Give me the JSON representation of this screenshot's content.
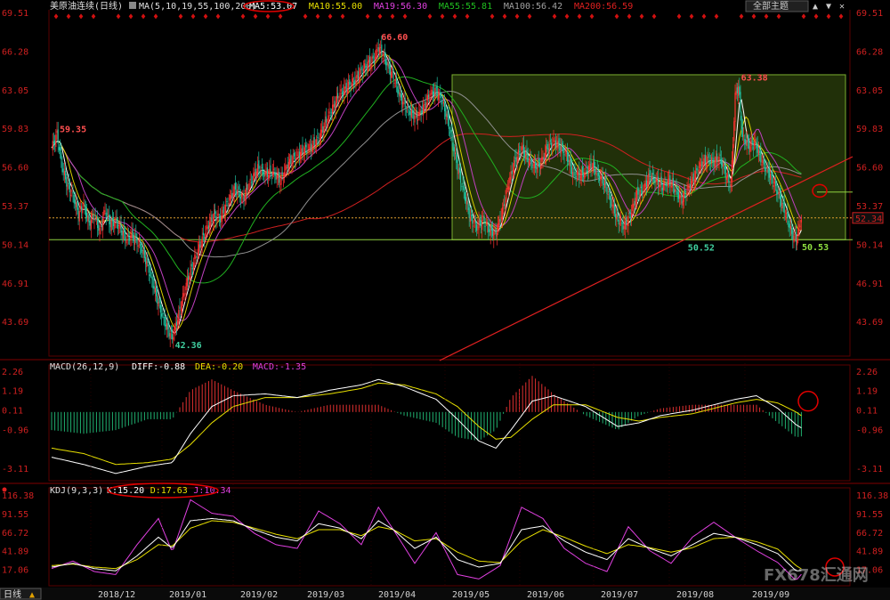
{
  "header": {
    "instrument": "美原油连续(日线)",
    "ma_params": "MA(5,10,19,55,100,200)",
    "ma_values": [
      {
        "label": "MA5:53.07",
        "color": "#ffffff"
      },
      {
        "label": "MA10:55.00",
        "color": "#e8e000"
      },
      {
        "label": "MA19:56.30",
        "color": "#e040e0"
      },
      {
        "label": "MA55:55.81",
        "color": "#20c020"
      },
      {
        "label": "MA100:56.42",
        "color": "#a0a0a0"
      },
      {
        "label": "MA200:56.59",
        "color": "#e02020"
      }
    ],
    "theme_button": "全部主题",
    "macd_header": "MACD(26,12,9)",
    "macd_values": [
      {
        "label": "DIFF:-0.88",
        "color": "#ffffff"
      },
      {
        "label": "DEA:-0.20",
        "color": "#e8e000"
      },
      {
        "label": "MACD:-1.35",
        "color": "#e040e0"
      }
    ],
    "kdj_header": "KDJ(9,3,3)",
    "kdj_values": [
      {
        "label": "K:15.20",
        "color": "#ffffff"
      },
      {
        "label": "D:17.63",
        "color": "#e8e000"
      },
      {
        "label": "J:10.34",
        "color": "#e040e0"
      }
    ],
    "period_tab": "日线",
    "watermark": "FX678汇通网"
  },
  "chart_data": [
    {
      "type": "candlestick",
      "yticks": [
        "69.51",
        "66.28",
        "63.05",
        "59.83",
        "56.60",
        "53.37",
        "50.14",
        "46.91",
        "43.69"
      ],
      "ylim": [
        40.8,
        69.8
      ],
      "xticks": [
        "2018/12",
        "2019/01",
        "2019/02",
        "2019/03",
        "2019/04",
        "2019/05",
        "2019/06",
        "2019/07",
        "2019/08",
        "2019/09"
      ],
      "current_price": "52.34",
      "annotations": [
        "59.35",
        "42.36",
        "66.60",
        "63.38",
        "50.52",
        "50.53"
      ],
      "price_path": [
        [
          0,
          58.2
        ],
        [
          5,
          59.35
        ],
        [
          10,
          56.5
        ],
        [
          15,
          55.0
        ],
        [
          20,
          54.2
        ],
        [
          25,
          52.7
        ],
        [
          30,
          53.4
        ],
        [
          35,
          51.9
        ],
        [
          40,
          52.6
        ],
        [
          45,
          51.2
        ],
        [
          50,
          53.0
        ],
        [
          55,
          51.8
        ],
        [
          60,
          52.1
        ],
        [
          65,
          51.3
        ],
        [
          70,
          50.6
        ],
        [
          75,
          50.9
        ],
        [
          80,
          50.4
        ],
        [
          85,
          49.6
        ],
        [
          90,
          48.3
        ],
        [
          95,
          46.8
        ],
        [
          100,
          45.2
        ],
        [
          105,
          43.8
        ],
        [
          110,
          42.8
        ],
        [
          113,
          42.36
        ],
        [
          117,
          43.6
        ],
        [
          122,
          45.4
        ],
        [
          128,
          47.4
        ],
        [
          134,
          48.9
        ],
        [
          140,
          50.3
        ],
        [
          146,
          51.6
        ],
        [
          152,
          52.5
        ],
        [
          158,
          52.3
        ],
        [
          165,
          53.6
        ],
        [
          172,
          54.8
        ],
        [
          179,
          53.9
        ],
        [
          186,
          55.3
        ],
        [
          193,
          56.5
        ],
        [
          200,
          56.0
        ],
        [
          207,
          56.2
        ],
        [
          214,
          55.4
        ],
        [
          221,
          56.8
        ],
        [
          228,
          57.4
        ],
        [
          235,
          57.9
        ],
        [
          242,
          58.2
        ],
        [
          249,
          58.8
        ],
        [
          256,
          60.2
        ],
        [
          263,
          61.5
        ],
        [
          270,
          62.7
        ],
        [
          277,
          63.3
        ],
        [
          284,
          63.8
        ],
        [
          290,
          64.6
        ],
        [
          296,
          65.2
        ],
        [
          302,
          65.6
        ],
        [
          306,
          66.6
        ],
        [
          311,
          65.8
        ],
        [
          316,
          64.8
        ],
        [
          321,
          63.9
        ],
        [
          326,
          62.5
        ],
        [
          331,
          61.7
        ],
        [
          336,
          61.1
        ],
        [
          342,
          60.8
        ],
        [
          348,
          61.5
        ],
        [
          354,
          62.6
        ],
        [
          360,
          63.0
        ],
        [
          366,
          62.0
        ],
        [
          371,
          60.5
        ],
        [
          376,
          58.3
        ],
        [
          381,
          56.2
        ],
        [
          386,
          54.5
        ],
        [
          392,
          52.3
        ],
        [
          398,
          51.6
        ],
        [
          404,
          52.2
        ],
        [
          410,
          51.3
        ],
        [
          416,
          51.1
        ],
        [
          422,
          52.9
        ],
        [
          428,
          55.3
        ],
        [
          434,
          57.2
        ],
        [
          440,
          58.2
        ],
        [
          446,
          57.3
        ],
        [
          452,
          56.6
        ],
        [
          458,
          56.9
        ],
        [
          464,
          58.2
        ],
        [
          470,
          58.7
        ],
        [
          476,
          58.3
        ],
        [
          482,
          57.6
        ],
        [
          488,
          56.1
        ],
        [
          494,
          55.9
        ],
        [
          500,
          56.2
        ],
        [
          506,
          56.8
        ],
        [
          512,
          55.9
        ],
        [
          518,
          55.2
        ],
        [
          524,
          53.6
        ],
        [
          530,
          52.2
        ],
        [
          536,
          51.6
        ],
        [
          542,
          52.6
        ],
        [
          548,
          54.3
        ],
        [
          554,
          54.7
        ],
        [
          560,
          55.9
        ],
        [
          566,
          55.4
        ],
        [
          572,
          55.0
        ],
        [
          578,
          55.4
        ],
        [
          584,
          54.7
        ],
        [
          590,
          53.8
        ],
        [
          596,
          54.8
        ],
        [
          602,
          55.8
        ],
        [
          608,
          56.8
        ],
        [
          614,
          57.2
        ],
        [
          620,
          57.0
        ],
        [
          626,
          57.3
        ],
        [
          632,
          55.8
        ],
        [
          636,
          55.0
        ],
        [
          640,
          62.5
        ],
        [
          643,
          63.38
        ],
        [
          647,
          59.0
        ],
        [
          653,
          58.4
        ],
        [
          659,
          58.6
        ],
        [
          665,
          57.0
        ],
        [
          671,
          56.2
        ],
        [
          677,
          55.1
        ],
        [
          683,
          53.7
        ],
        [
          688,
          52.5
        ],
        [
          693,
          51.0
        ],
        [
          697,
          50.53
        ],
        [
          702,
          52.34
        ]
      ]
    },
    {
      "type": "macd",
      "yticks": [
        "2.26",
        "1.19",
        "0.11",
        "-0.96",
        "-3.11"
      ],
      "ylim": [
        -3.8,
        2.6
      ],
      "diff_path": [
        [
          0,
          -2.5
        ],
        [
          30,
          -2.9
        ],
        [
          60,
          -3.4
        ],
        [
          90,
          -3.0
        ],
        [
          113,
          -2.8
        ],
        [
          130,
          -1.2
        ],
        [
          150,
          0.3
        ],
        [
          170,
          0.9
        ],
        [
          200,
          1.0
        ],
        [
          230,
          0.8
        ],
        [
          260,
          1.2
        ],
        [
          290,
          1.5
        ],
        [
          306,
          1.8
        ],
        [
          330,
          1.4
        ],
        [
          360,
          0.7
        ],
        [
          380,
          -0.4
        ],
        [
          400,
          -1.6
        ],
        [
          416,
          -2.0
        ],
        [
          430,
          -1.0
        ],
        [
          450,
          0.6
        ],
        [
          470,
          0.9
        ],
        [
          500,
          0.3
        ],
        [
          530,
          -0.8
        ],
        [
          550,
          -0.6
        ],
        [
          570,
          -0.2
        ],
        [
          600,
          0.1
        ],
        [
          620,
          0.4
        ],
        [
          640,
          0.7
        ],
        [
          660,
          0.9
        ],
        [
          680,
          0.2
        ],
        [
          697,
          -0.7
        ],
        [
          702,
          -0.88
        ]
      ],
      "dea_path": [
        [
          0,
          -2.0
        ],
        [
          30,
          -2.3
        ],
        [
          60,
          -2.9
        ],
        [
          90,
          -2.8
        ],
        [
          113,
          -2.6
        ],
        [
          130,
          -1.8
        ],
        [
          150,
          -0.6
        ],
        [
          170,
          0.3
        ],
        [
          200,
          0.8
        ],
        [
          230,
          0.8
        ],
        [
          260,
          1.0
        ],
        [
          290,
          1.3
        ],
        [
          306,
          1.6
        ],
        [
          330,
          1.5
        ],
        [
          360,
          1.0
        ],
        [
          380,
          0.3
        ],
        [
          400,
          -0.8
        ],
        [
          416,
          -1.5
        ],
        [
          430,
          -1.4
        ],
        [
          450,
          -0.4
        ],
        [
          470,
          0.4
        ],
        [
          500,
          0.4
        ],
        [
          530,
          -0.3
        ],
        [
          550,
          -0.5
        ],
        [
          570,
          -0.3
        ],
        [
          600,
          -0.1
        ],
        [
          620,
          0.2
        ],
        [
          640,
          0.5
        ],
        [
          660,
          0.7
        ],
        [
          680,
          0.5
        ],
        [
          697,
          0.0
        ],
        [
          702,
          -0.2
        ]
      ],
      "hist_path": [
        [
          0,
          -1.0
        ],
        [
          30,
          -1.2
        ],
        [
          60,
          -1.0
        ],
        [
          90,
          -0.4
        ],
        [
          113,
          -0.4
        ],
        [
          130,
          1.2
        ],
        [
          150,
          1.8
        ],
        [
          170,
          1.2
        ],
        [
          200,
          0.4
        ],
        [
          230,
          0.0
        ],
        [
          260,
          0.4
        ],
        [
          290,
          0.4
        ],
        [
          306,
          0.4
        ],
        [
          330,
          -0.2
        ],
        [
          360,
          -0.6
        ],
        [
          380,
          -1.4
        ],
        [
          400,
          -1.6
        ],
        [
          416,
          -1.0
        ],
        [
          430,
          0.8
        ],
        [
          450,
          2.0
        ],
        [
          470,
          1.0
        ],
        [
          500,
          -0.2
        ],
        [
          530,
          -1.0
        ],
        [
          550,
          -0.2
        ],
        [
          570,
          0.2
        ],
        [
          600,
          0.4
        ],
        [
          620,
          0.4
        ],
        [
          640,
          0.4
        ],
        [
          660,
          0.4
        ],
        [
          680,
          -0.6
        ],
        [
          697,
          -1.4
        ],
        [
          702,
          -1.35
        ]
      ]
    },
    {
      "type": "kdj",
      "yticks": [
        "116.38",
        "91.55",
        "66.72",
        "41.89",
        "17.06"
      ],
      "ylim": [
        -5,
        126
      ],
      "k_path": [
        [
          0,
          20
        ],
        [
          20,
          25
        ],
        [
          40,
          18
        ],
        [
          60,
          15
        ],
        [
          80,
          35
        ],
        [
          100,
          60
        ],
        [
          113,
          45
        ],
        [
          130,
          82
        ],
        [
          150,
          85
        ],
        [
          170,
          82
        ],
        [
          190,
          70
        ],
        [
          210,
          60
        ],
        [
          230,
          55
        ],
        [
          250,
          78
        ],
        [
          270,
          72
        ],
        [
          290,
          58
        ],
        [
          306,
          82
        ],
        [
          320,
          70
        ],
        [
          340,
          45
        ],
        [
          360,
          60
        ],
        [
          380,
          30
        ],
        [
          400,
          20
        ],
        [
          420,
          25
        ],
        [
          440,
          70
        ],
        [
          460,
          75
        ],
        [
          480,
          55
        ],
        [
          500,
          40
        ],
        [
          520,
          30
        ],
        [
          540,
          58
        ],
        [
          560,
          45
        ],
        [
          580,
          35
        ],
        [
          600,
          50
        ],
        [
          620,
          65
        ],
        [
          640,
          60
        ],
        [
          660,
          50
        ],
        [
          680,
          38
        ],
        [
          697,
          15
        ],
        [
          702,
          15.2
        ]
      ],
      "d_path": [
        [
          0,
          22
        ],
        [
          20,
          24
        ],
        [
          40,
          20
        ],
        [
          60,
          18
        ],
        [
          80,
          30
        ],
        [
          100,
          50
        ],
        [
          113,
          48
        ],
        [
          130,
          72
        ],
        [
          150,
          82
        ],
        [
          170,
          80
        ],
        [
          190,
          72
        ],
        [
          210,
          64
        ],
        [
          230,
          58
        ],
        [
          250,
          70
        ],
        [
          270,
          70
        ],
        [
          290,
          62
        ],
        [
          306,
          74
        ],
        [
          320,
          70
        ],
        [
          340,
          55
        ],
        [
          360,
          58
        ],
        [
          380,
          40
        ],
        [
          400,
          28
        ],
        [
          420,
          26
        ],
        [
          440,
          55
        ],
        [
          460,
          70
        ],
        [
          480,
          60
        ],
        [
          500,
          48
        ],
        [
          520,
          38
        ],
        [
          540,
          50
        ],
        [
          560,
          46
        ],
        [
          580,
          40
        ],
        [
          600,
          46
        ],
        [
          620,
          58
        ],
        [
          640,
          60
        ],
        [
          660,
          54
        ],
        [
          680,
          44
        ],
        [
          697,
          22
        ],
        [
          702,
          17.63
        ]
      ],
      "j_path": [
        [
          0,
          18
        ],
        [
          20,
          28
        ],
        [
          40,
          14
        ],
        [
          60,
          10
        ],
        [
          80,
          50
        ],
        [
          100,
          85
        ],
        [
          113,
          40
        ],
        [
          130,
          110
        ],
        [
          150,
          92
        ],
        [
          170,
          88
        ],
        [
          190,
          65
        ],
        [
          210,
          50
        ],
        [
          230,
          45
        ],
        [
          250,
          95
        ],
        [
          270,
          78
        ],
        [
          290,
          50
        ],
        [
          306,
          100
        ],
        [
          320,
          70
        ],
        [
          340,
          25
        ],
        [
          360,
          66
        ],
        [
          380,
          10
        ],
        [
          400,
          4
        ],
        [
          420,
          22
        ],
        [
          440,
          100
        ],
        [
          460,
          85
        ],
        [
          480,
          45
        ],
        [
          500,
          25
        ],
        [
          520,
          14
        ],
        [
          540,
          74
        ],
        [
          560,
          42
        ],
        [
          580,
          25
        ],
        [
          600,
          60
        ],
        [
          620,
          80
        ],
        [
          640,
          60
        ],
        [
          660,
          42
        ],
        [
          680,
          26
        ],
        [
          697,
          2
        ],
        [
          702,
          10.34
        ]
      ]
    }
  ]
}
